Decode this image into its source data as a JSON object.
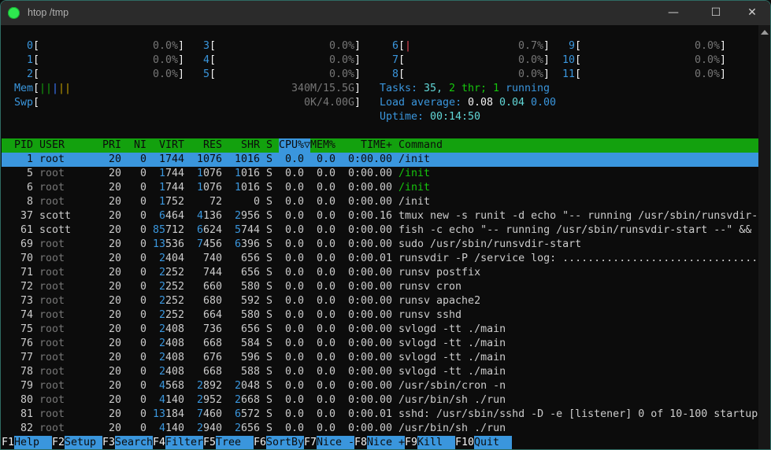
{
  "window": {
    "title": "htop /tmp",
    "controls": {
      "minimize": "—",
      "maximize": "☐",
      "close": "✕"
    }
  },
  "meters": {
    "cpus": [
      {
        "id": "0",
        "text": "0.0%",
        "usage_percent": 0.0
      },
      {
        "id": "1",
        "text": "0.0%",
        "usage_percent": 0.0
      },
      {
        "id": "2",
        "text": "0.0%",
        "usage_percent": 0.0
      },
      {
        "id": "3",
        "text": "0.0%",
        "usage_percent": 0.0
      },
      {
        "id": "4",
        "text": "0.0%",
        "usage_percent": 0.0
      },
      {
        "id": "5",
        "text": "0.0%",
        "usage_percent": 0.0
      },
      {
        "id": "6",
        "text": "0.7%",
        "usage_percent": 0.7
      },
      {
        "id": "7",
        "text": "0.0%",
        "usage_percent": 0.0
      },
      {
        "id": "8",
        "text": "0.0%",
        "usage_percent": 0.0
      },
      {
        "id": "9",
        "text": "0.0%",
        "usage_percent": 0.0
      },
      {
        "id": "10",
        "text": "0.0%",
        "usage_percent": 0.0
      },
      {
        "id": "11",
        "text": "0.0%",
        "usage_percent": 0.0
      }
    ],
    "mem": {
      "label": "Mem",
      "text": "340M/15.5G",
      "bar_colors": [
        "#13a10e",
        "#13a10e",
        "#3b78ff",
        "#c19c00",
        "#c19c00"
      ]
    },
    "swap": {
      "label": "Swp",
      "text": "0K/4.00G"
    },
    "tasks": {
      "label": "Tasks: ",
      "count": "35,",
      "threads": "2 thr;",
      "running_count": "1",
      "running_label": "running"
    },
    "load": {
      "label": "Load average: ",
      "one": "0.08",
      "five": "0.04",
      "fifteen": "0.00"
    },
    "uptime": {
      "label": "Uptime: ",
      "value": "00:14:50"
    }
  },
  "columns": {
    "pid": "PID",
    "user": "USER",
    "pri": "PRI",
    "ni": "NI",
    "virt": "VIRT",
    "res": "RES",
    "shr": "SHR",
    "s": "S",
    "cpu": "CPU%▽",
    "mem": "MEM%",
    "time": "TIME+",
    "command": "Command"
  },
  "processes": [
    {
      "pid": "1",
      "user": "root",
      "pri": "20",
      "ni": "0",
      "virt": "1744",
      "res": "1076",
      "shr": "1016",
      "s": "S",
      "cpu": "0.0",
      "mem": "0.0",
      "time": "0:00.00",
      "command": "/init",
      "selected": true
    },
    {
      "pid": "5",
      "user": "root",
      "pri": "20",
      "ni": "0",
      "virt": "1744",
      "res": "1076",
      "shr": "1016",
      "s": "S",
      "cpu": "0.0",
      "mem": "0.0",
      "time": "0:00.00",
      "command": "/init",
      "thread": true
    },
    {
      "pid": "6",
      "user": "root",
      "pri": "20",
      "ni": "0",
      "virt": "1744",
      "res": "1076",
      "shr": "1016",
      "s": "S",
      "cpu": "0.0",
      "mem": "0.0",
      "time": "0:00.00",
      "command": "/init",
      "thread": true
    },
    {
      "pid": "8",
      "user": "root",
      "pri": "20",
      "ni": "0",
      "virt": "1752",
      "res": "72",
      "shr": "0",
      "s": "S",
      "cpu": "0.0",
      "mem": "0.0",
      "time": "0:00.00",
      "command": "/init"
    },
    {
      "pid": "37",
      "user": "scott",
      "pri": "20",
      "ni": "0",
      "virt": "6464",
      "res": "4136",
      "shr": "2956",
      "s": "S",
      "cpu": "0.0",
      "mem": "0.0",
      "time": "0:00.16",
      "command": "tmux new -s runit -d echo \"-- running /usr/sbin/runsvdir-"
    },
    {
      "pid": "61",
      "user": "scott",
      "pri": "20",
      "ni": "0",
      "virt": "85712",
      "res": "6624",
      "shr": "5744",
      "s": "S",
      "cpu": "0.0",
      "mem": "0.0",
      "time": "0:00.00",
      "command": "fish -c echo \"-- running /usr/sbin/runsvdir-start --\" &&"
    },
    {
      "pid": "69",
      "user": "root",
      "pri": "20",
      "ni": "0",
      "virt": "13536",
      "res": "7456",
      "shr": "6396",
      "s": "S",
      "cpu": "0.0",
      "mem": "0.0",
      "time": "0:00.00",
      "command": "sudo /usr/sbin/runsvdir-start"
    },
    {
      "pid": "70",
      "user": "root",
      "pri": "20",
      "ni": "0",
      "virt": "2404",
      "res": "740",
      "shr": "656",
      "s": "S",
      "cpu": "0.0",
      "mem": "0.0",
      "time": "0:00.01",
      "command": "runsvdir -P /service log: ..............................."
    },
    {
      "pid": "71",
      "user": "root",
      "pri": "20",
      "ni": "0",
      "virt": "2252",
      "res": "744",
      "shr": "656",
      "s": "S",
      "cpu": "0.0",
      "mem": "0.0",
      "time": "0:00.00",
      "command": "runsv postfix"
    },
    {
      "pid": "72",
      "user": "root",
      "pri": "20",
      "ni": "0",
      "virt": "2252",
      "res": "660",
      "shr": "580",
      "s": "S",
      "cpu": "0.0",
      "mem": "0.0",
      "time": "0:00.00",
      "command": "runsv cron"
    },
    {
      "pid": "73",
      "user": "root",
      "pri": "20",
      "ni": "0",
      "virt": "2252",
      "res": "680",
      "shr": "592",
      "s": "S",
      "cpu": "0.0",
      "mem": "0.0",
      "time": "0:00.00",
      "command": "runsv apache2"
    },
    {
      "pid": "74",
      "user": "root",
      "pri": "20",
      "ni": "0",
      "virt": "2252",
      "res": "664",
      "shr": "580",
      "s": "S",
      "cpu": "0.0",
      "mem": "0.0",
      "time": "0:00.00",
      "command": "runsv sshd"
    },
    {
      "pid": "75",
      "user": "root",
      "pri": "20",
      "ni": "0",
      "virt": "2408",
      "res": "736",
      "shr": "656",
      "s": "S",
      "cpu": "0.0",
      "mem": "0.0",
      "time": "0:00.00",
      "command": "svlogd -tt ./main"
    },
    {
      "pid": "76",
      "user": "root",
      "pri": "20",
      "ni": "0",
      "virt": "2408",
      "res": "668",
      "shr": "584",
      "s": "S",
      "cpu": "0.0",
      "mem": "0.0",
      "time": "0:00.00",
      "command": "svlogd -tt ./main"
    },
    {
      "pid": "77",
      "user": "root",
      "pri": "20",
      "ni": "0",
      "virt": "2408",
      "res": "676",
      "shr": "596",
      "s": "S",
      "cpu": "0.0",
      "mem": "0.0",
      "time": "0:00.00",
      "command": "svlogd -tt ./main"
    },
    {
      "pid": "78",
      "user": "root",
      "pri": "20",
      "ni": "0",
      "virt": "2408",
      "res": "668",
      "shr": "588",
      "s": "S",
      "cpu": "0.0",
      "mem": "0.0",
      "time": "0:00.00",
      "command": "svlogd -tt ./main"
    },
    {
      "pid": "79",
      "user": "root",
      "pri": "20",
      "ni": "0",
      "virt": "4568",
      "res": "2892",
      "shr": "2048",
      "s": "S",
      "cpu": "0.0",
      "mem": "0.0",
      "time": "0:00.00",
      "command": "/usr/sbin/cron -n"
    },
    {
      "pid": "80",
      "user": "root",
      "pri": "20",
      "ni": "0",
      "virt": "4140",
      "res": "2952",
      "shr": "2668",
      "s": "S",
      "cpu": "0.0",
      "mem": "0.0",
      "time": "0:00.00",
      "command": "/usr/bin/sh ./run"
    },
    {
      "pid": "81",
      "user": "root",
      "pri": "20",
      "ni": "0",
      "virt": "13184",
      "res": "7460",
      "shr": "6572",
      "s": "S",
      "cpu": "0.0",
      "mem": "0.0",
      "time": "0:00.01",
      "command": "sshd: /usr/sbin/sshd -D -e [listener] 0 of 10-100 startup"
    },
    {
      "pid": "82",
      "user": "root",
      "pri": "20",
      "ni": "0",
      "virt": "4140",
      "res": "2940",
      "shr": "2656",
      "s": "S",
      "cpu": "0.0",
      "mem": "0.0",
      "time": "0:00.00",
      "command": "/usr/bin/sh ./run"
    }
  ],
  "footer": [
    {
      "key": "F1",
      "label": "Help"
    },
    {
      "key": "F2",
      "label": "Setup"
    },
    {
      "key": "F3",
      "label": "Search"
    },
    {
      "key": "F4",
      "label": "Filter"
    },
    {
      "key": "F5",
      "label": "Tree"
    },
    {
      "key": "F6",
      "label": "SortBy"
    },
    {
      "key": "F7",
      "label": "Nice -"
    },
    {
      "key": "F8",
      "label": "Nice +"
    },
    {
      "key": "F9",
      "label": "Kill"
    },
    {
      "key": "F10",
      "label": "Quit"
    }
  ],
  "colors": {
    "blue": "#3a96dd",
    "green_header": "#13a10e",
    "background": "#0c0c0c"
  }
}
